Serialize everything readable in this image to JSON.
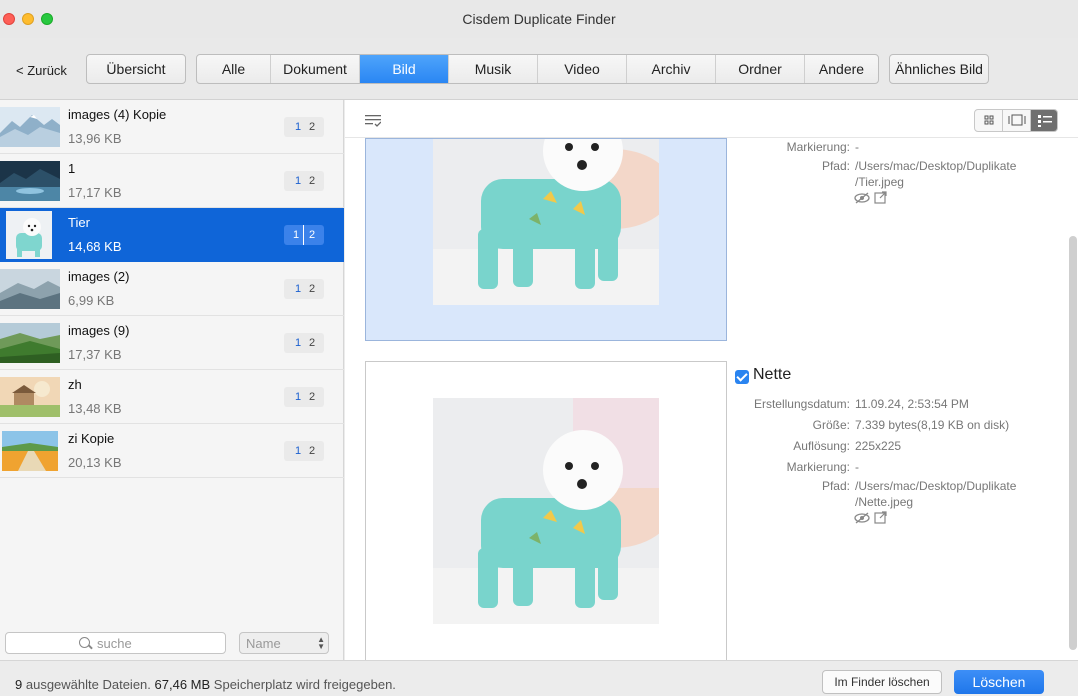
{
  "window": {
    "title": "Cisdem Duplicate Finder"
  },
  "toolbar": {
    "back_label": "< Zurück",
    "overview_label": "Übersicht",
    "tabs": [
      {
        "label": "Alle"
      },
      {
        "label": "Dokument"
      },
      {
        "label": "Bild",
        "active": true
      },
      {
        "label": "Musik"
      },
      {
        "label": "Video"
      },
      {
        "label": "Archiv"
      },
      {
        "label": "Ordner"
      },
      {
        "label": "Andere"
      }
    ],
    "similar_label": "Ähnliches Bild"
  },
  "sidebar": {
    "items": [
      {
        "name": "images (4) Kopie",
        "size": "13,96 KB",
        "badge_a": "1",
        "badge_b": "2",
        "thumb": "snowy-mountains"
      },
      {
        "name": "1",
        "size": "17,17 KB",
        "badge_a": "1",
        "badge_b": "2",
        "thumb": "lake-night"
      },
      {
        "name": "Tier",
        "size": "14,68 KB",
        "badge_a": "1",
        "badge_b": "2",
        "thumb": "dog",
        "selected": true
      },
      {
        "name": "images (2)",
        "size": "6,99 KB",
        "badge_a": "1",
        "badge_b": "2",
        "thumb": "misty-hills"
      },
      {
        "name": "images (9)",
        "size": "17,37 KB",
        "badge_a": "1",
        "badge_b": "2",
        "thumb": "tea-field"
      },
      {
        "name": "zh",
        "size": "13,48 KB",
        "badge_a": "1",
        "badge_b": "2",
        "thumb": "cottage"
      },
      {
        "name": "zi Kopie",
        "size": "20,13 KB",
        "badge_a": "1",
        "badge_b": "2",
        "thumb": "flower-path"
      }
    ],
    "search_placeholder": "suche",
    "sort_value": "Name"
  },
  "detail": {
    "files": [
      {
        "labels": {
          "mark": "Markierung:",
          "path": "Pfad:"
        },
        "mark": "-",
        "path_line1": "/Users/mac/Desktop/Duplikate",
        "path_line2": "/Tier.jpeg"
      },
      {
        "checked": true,
        "title": "Nette",
        "labels": {
          "created": "Erstellungsdatum:",
          "size": "Größe:",
          "resolution": "Auflösung:",
          "mark": "Markierung:",
          "path": "Pfad:"
        },
        "created": "11.09.24, 2:53:54 PM",
        "size": "7.339 bytes(8,19 KB on disk)",
        "resolution": "225x225",
        "mark": "-",
        "path_line1": "/Users/mac/Desktop/Duplikate",
        "path_line2": "/Nette.jpeg"
      }
    ]
  },
  "status": {
    "count": "9",
    "text_a": "ausgewählte Dateien.",
    "size": "67,46 MB",
    "text_b": "Speicherplatz wird freigegeben.",
    "finder_label": "Im Finder löschen",
    "delete_label": "Löschen"
  },
  "colors": {
    "accent": "#0f65d8",
    "button_blue": "#2a86f3"
  }
}
